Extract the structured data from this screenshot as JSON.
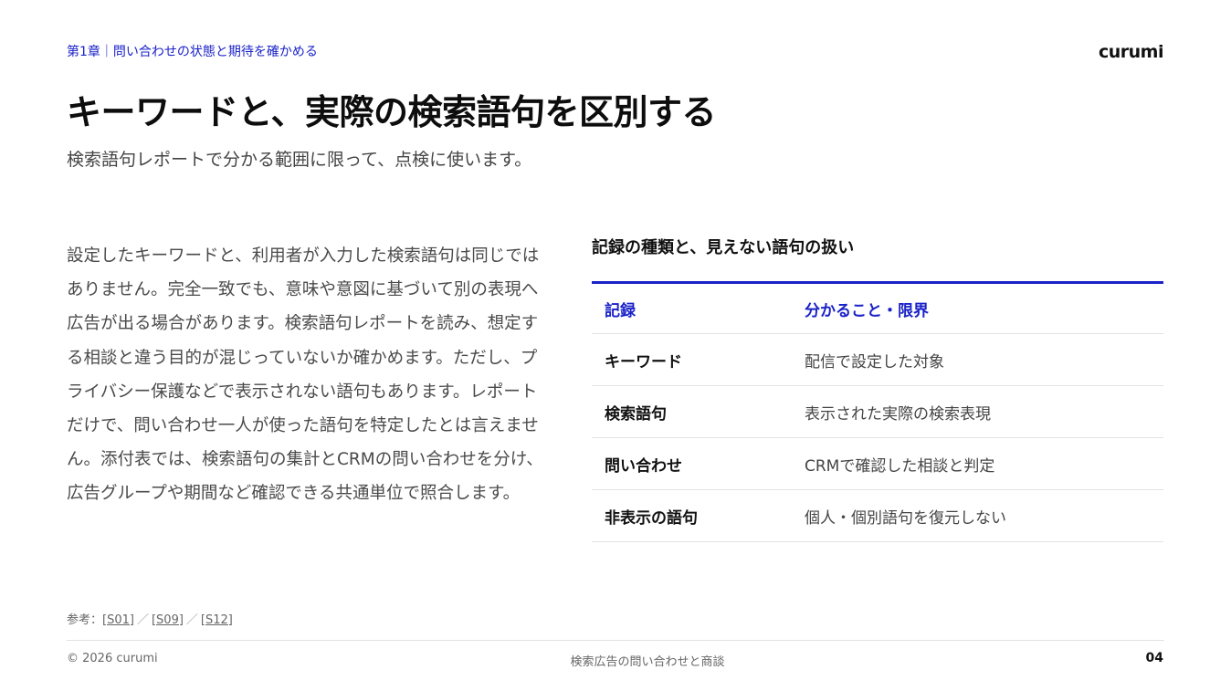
{
  "header": {
    "chapter": "第1章｜問い合わせの状態と期待を確かめる",
    "brand": "curumi"
  },
  "title": "キーワードと、実際の検索語句を区別する",
  "subtitle": "検索語句レポートで分かる範囲に限って、点検に使います。",
  "body": "設定したキーワードと、利用者が入力した検索語句は同じではありません。完全一致でも、意味や意図に基づいて別の表現へ広告が出る場合があります。検索語句レポートを読み、想定する相談と違う目的が混じっていないか確かめます。ただし、プライバシー保護などで表示されない語句もあります。レポートだけで、問い合わせ一人が使った語句を特定したとは言えません。添付表では、検索語句の集計とCRMの問い合わせを分け、広告グループや期間など確認できる共通単位で照合します。",
  "table": {
    "heading": "記録の種類と、見えない語句の扱い",
    "columns": [
      "記録",
      "分かること・限界"
    ],
    "rows": [
      {
        "record": "キーワード",
        "detail": "配信で設定した対象"
      },
      {
        "record": "検索語句",
        "detail": "表示された実際の検索表現"
      },
      {
        "record": "問い合わせ",
        "detail": "CRMで確認した相談と判定"
      },
      {
        "record": "非表示の語句",
        "detail": "個人・個別語句を復元しない"
      }
    ]
  },
  "references": {
    "label": "参考：",
    "items": [
      "[S01]",
      "[S09]",
      "[S12]"
    ],
    "separator": "／"
  },
  "footer": {
    "copyright": "© 2026 curumi",
    "center": "検索広告の問い合わせと商談",
    "page": "04"
  },
  "colors": {
    "accent": "#1a22c8",
    "text": "#1a1a1a",
    "muted": "#666666",
    "rule": "#e2e2e2"
  }
}
